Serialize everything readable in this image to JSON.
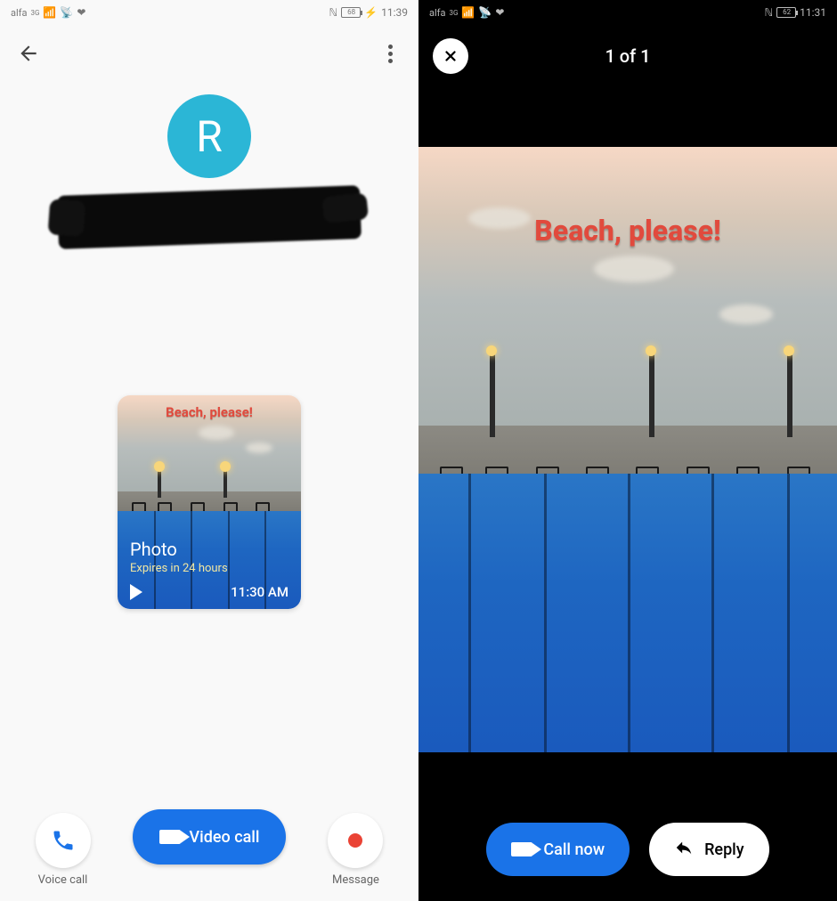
{
  "left": {
    "status": {
      "carrier": "alfa",
      "net": "3G",
      "battery": "68",
      "time": "11:39"
    },
    "avatar_initial": "R",
    "card": {
      "caption": "Beach, please!",
      "title": "Photo",
      "expires": "Expires in 24 hours",
      "time": "11:30 AM"
    },
    "actions": {
      "voice_label": "Voice call",
      "video_label": "Video call",
      "message_label": "Message"
    }
  },
  "right": {
    "status": {
      "carrier": "alfa",
      "net": "3G",
      "battery": "62",
      "time": "11:31"
    },
    "counter": "1 of 1",
    "caption": "Beach, please!",
    "actions": {
      "call_label": "Call now",
      "reply_label": "Reply"
    }
  }
}
